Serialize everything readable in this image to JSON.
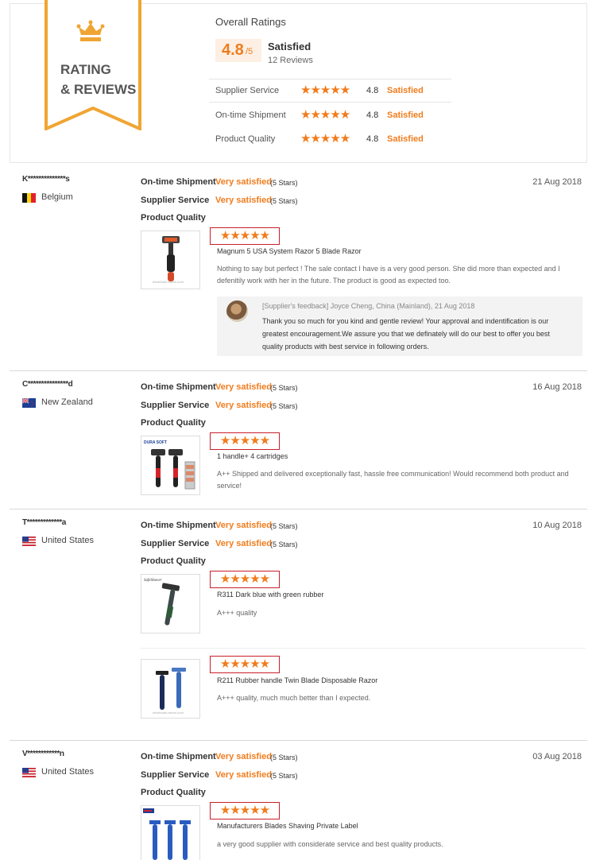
{
  "ribbon": {
    "line1": "RATING",
    "line2": "& REVIEWS"
  },
  "overall": {
    "title": "Overall Ratings",
    "score": "4.8",
    "score_out_of": "/5",
    "label": "Satisfied",
    "reviews_count": "12 Reviews",
    "rows": [
      {
        "label": "Supplier Service",
        "stars": "★★★★★",
        "score": "4.8",
        "status": "Satisfied"
      },
      {
        "label": "On-time Shipment",
        "stars": "★★★★★",
        "score": "4.8",
        "status": "Satisfied"
      },
      {
        "label": "Product Quality",
        "stars": "★★★★★",
        "score": "4.8",
        "status": "Satisfied"
      }
    ]
  },
  "labels": {
    "shipment": "On-time Shipment",
    "service": "Supplier Service",
    "quality": "Product Quality",
    "very_satisfied": "Very satisfied",
    "five_stars": "(5 Stars)",
    "star_glyphs": "★★★★★"
  },
  "reviews": [
    {
      "user": "K**************s",
      "country": "Belgium",
      "date": "21 Aug 2018",
      "products": [
        {
          "name": "Magnum 5 USA System Razor 5 Blade Razor",
          "comment": "Nothing to say but perfect ! The sale contact I have is a very good person. She did more than expected and I defenitily work with her in the future. The product is good as expected too.",
          "thumb_caption": "wholesale-razors.com"
        }
      ],
      "feedback": {
        "header": "[Supplier's feedback] Joyce Cheng, China (Mainland), 21 Aug 2018",
        "text": "Thank you so much for you kind and gentle review! Your approval and indentification is our greatest encouragement.We assure you that we definately will do our best to offer you best quality products with best service in following orders."
      }
    },
    {
      "user": "C***************d",
      "country": "New Zealand",
      "date": "16 Aug 2018",
      "products": [
        {
          "name": "1 handle+ 4 cartridges",
          "comment": "A++ Shipped and delivered exceptionally fast, hassle free communication! Would recommend both product and service!",
          "thumb_caption": "DURA SOFT"
        }
      ]
    },
    {
      "user": "T*************a",
      "country": "United States",
      "date": "10 Aug 2018",
      "products": [
        {
          "name": "R311 Dark blue with green rubber",
          "comment": "A+++ quality",
          "thumb_caption": "SafeShaver"
        },
        {
          "name": "R211 Rubber handle Twin Blade Disposable Razor",
          "comment": "A+++ quality, much much better than I expected.",
          "thumb_caption": "wholesale-razors.com"
        }
      ]
    },
    {
      "user": "V************n",
      "country": "United States",
      "date": "03 Aug 2018",
      "products": [
        {
          "name": "Manufacturers Blades Shaving Private Label",
          "comment": "a very good supplier with considerate service and best quality products.",
          "thumb_caption": ""
        }
      ]
    }
  ],
  "colors": {
    "accent": "#f07c1d",
    "ribbon": "#f0a533",
    "highlight_border": "#c8202a"
  }
}
